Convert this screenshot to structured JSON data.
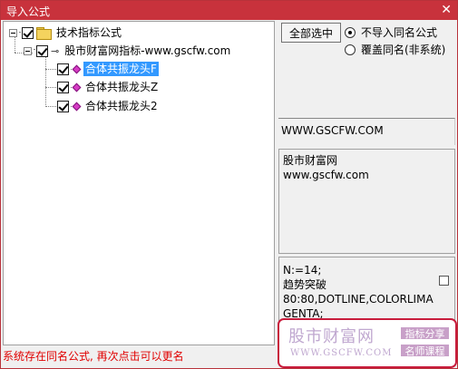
{
  "window": {
    "title": "导入公式",
    "close_glyph": "✕"
  },
  "tree": {
    "root": {
      "label": "技术指标公式",
      "checked": true
    },
    "group": {
      "label": "股市财富网指标-www.gscfw.com",
      "checked": true
    },
    "items": [
      {
        "label": "合体共振龙头F",
        "checked": true,
        "selected": true
      },
      {
        "label": "合体共振龙头Z",
        "checked": true,
        "selected": false
      },
      {
        "label": "合体共振龙头2",
        "checked": true,
        "selected": false
      }
    ]
  },
  "options": {
    "select_all_label": "全部选中",
    "radio_skip_label": "不导入同名公式",
    "radio_overwrite_label": "覆盖同名(非系统)",
    "selected_radio": "skip"
  },
  "info": {
    "url_text": "WWW.GSCFW.COM",
    "desc_line1": "股市财富网",
    "desc_line2": "www.gscfw.com"
  },
  "code": {
    "line1": " N:=14;",
    "line2": "趋势突破",
    "line3": "80:80,DOTLINE,COLORLIMA",
    "line4": "GENTA;"
  },
  "watermark": {
    "brand": "股市财富网",
    "url": "WWW.GSCFW.COM",
    "tag1": "指标分享",
    "tag2": "名师课程"
  },
  "status": {
    "message": "系统存在同名公式, 再次点击可以更名"
  },
  "colors": {
    "titlebar": "#c8323c",
    "selection": "#3399ff",
    "status_text": "#e00000",
    "item_icon": "#d63cc4"
  }
}
